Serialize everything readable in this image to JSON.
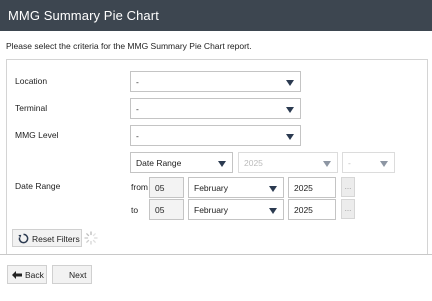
{
  "header": {
    "title": "MMG Summary Pie Chart"
  },
  "intro_text": "Please select the criteria for the MMG Summary Pie Chart report.",
  "form": {
    "location": {
      "label": "Location",
      "value": "-"
    },
    "terminal": {
      "label": "Terminal",
      "value": "-"
    },
    "mmg_level": {
      "label": "MMG Level",
      "value": "-"
    },
    "date_range": {
      "label": "Date Range",
      "type_value": "Date Range",
      "year_value": "2025",
      "period_value": "-",
      "from": {
        "prefix": "from",
        "day": "05",
        "month": "February",
        "year": "2025",
        "picker": "..."
      },
      "to": {
        "prefix": "to",
        "day": "05",
        "month": "February",
        "year": "2025",
        "picker": "..."
      }
    },
    "reset_label": "Reset Filters"
  },
  "nav": {
    "back_label": "Back",
    "next_label": "Next"
  },
  "icons": {
    "reset": "reset-icon",
    "spinner": "loading-spinner-icon",
    "back": "arrow-left-icon"
  },
  "colors": {
    "header_bg": "#3d4650",
    "caret": "#2b3a50"
  }
}
